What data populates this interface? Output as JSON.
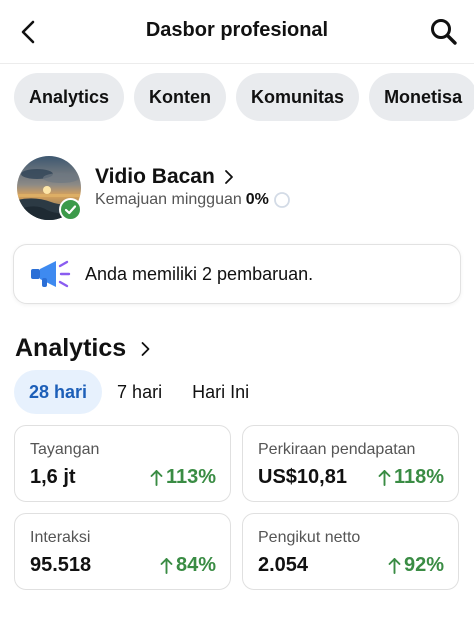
{
  "header": {
    "title": "Dasbor profesional"
  },
  "tabs": [
    {
      "label": "Analytics"
    },
    {
      "label": "Konten"
    },
    {
      "label": "Komunitas"
    },
    {
      "label": "Monetisa"
    }
  ],
  "profile": {
    "name": "Vidio Bacan",
    "progress_label": "Kemajuan mingguan",
    "progress_value": "0%"
  },
  "updates": {
    "text": "Anda memiliki 2 pembaruan."
  },
  "analytics": {
    "title": "Analytics",
    "ranges": [
      {
        "label": "28 hari",
        "active": true
      },
      {
        "label": "7 hari",
        "active": false
      },
      {
        "label": "Hari Ini",
        "active": false
      }
    ],
    "metrics": [
      {
        "label": "Tayangan",
        "value": "1,6 jt",
        "change": "113%"
      },
      {
        "label": "Perkiraan pendapatan",
        "value": "US$10,81",
        "change": "118%"
      },
      {
        "label": "Interaksi",
        "value": "95.518",
        "change": "84%"
      },
      {
        "label": "Pengikut netto",
        "value": "2.054",
        "change": "92%"
      }
    ]
  },
  "colors": {
    "accent_blue": "#1d5fb8",
    "positive_green": "#3a8c44",
    "tab_bg": "#e9ebee"
  },
  "icons": [
    "back-arrow-icon",
    "search-icon",
    "chevron-right-icon",
    "verified-check-icon",
    "megaphone-icon",
    "arrow-up-icon"
  ]
}
